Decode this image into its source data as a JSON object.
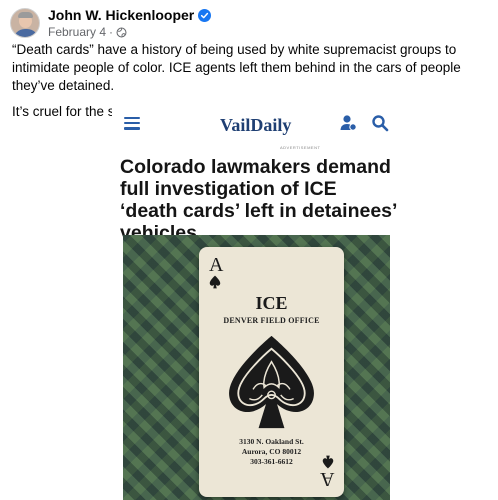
{
  "post": {
    "author": "John W. Hickenlooper",
    "date": "February 4",
    "separator": "·",
    "paragraphs": [
      "“Death cards” have a history of being used by white supremacist groups to intimidate people of color. ICE agents left them behind in the cars of people they’ve detained.",
      "It’s cruel for the sake of being cruel."
    ]
  },
  "embed": {
    "logo": "VailDaily",
    "ad_label": "ADVERTISEMENT",
    "headline": "Colorado lawmakers demand full investigation of ICE ‘death cards’ left in detainees’ vehicles",
    "card": {
      "rank": "A",
      "title": "ICE",
      "subtitle": "DENVER FIELD OFFICE",
      "address_line1": "3130 N. Oakland St.",
      "address_line2": "Aurora, CO 80012",
      "phone": "303-361-6612"
    }
  },
  "colors": {
    "verified_badge": "#1877f2",
    "nav_icon": "#2a5ea8",
    "logo": "#1f3f73",
    "meta_text": "#65676b"
  },
  "icons": [
    "verified-badge-icon",
    "globe-icon",
    "menu-icon",
    "user-icon",
    "search-icon",
    "spade-icon"
  ]
}
